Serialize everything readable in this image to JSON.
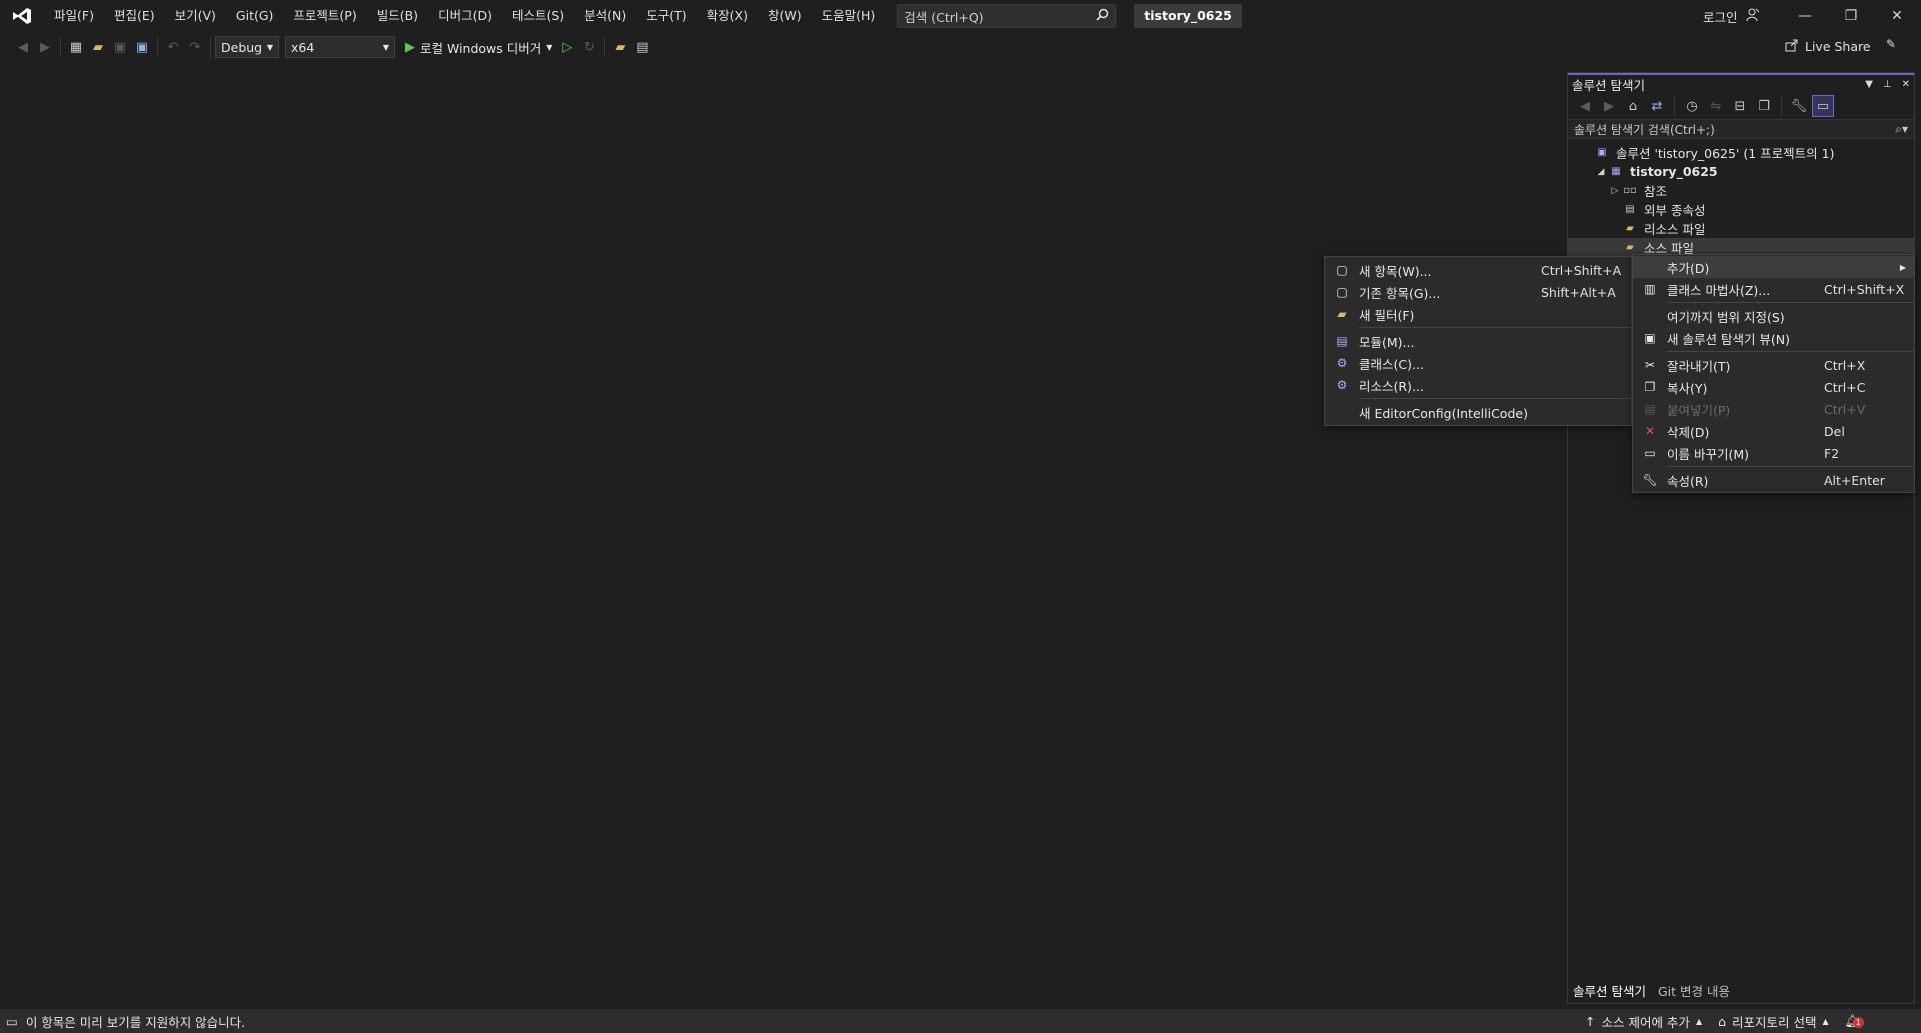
{
  "menu": {
    "items": [
      "파일(F)",
      "편집(E)",
      "보기(V)",
      "Git(G)",
      "프로젝트(P)",
      "빌드(B)",
      "디버그(D)",
      "테스트(S)",
      "분석(N)",
      "도구(T)",
      "확장(X)",
      "창(W)",
      "도움말(H)"
    ]
  },
  "search": {
    "placeholder": "검색 (Ctrl+Q)"
  },
  "solution_name": "tistory_0625",
  "account": {
    "login_label": "로그인"
  },
  "toolbar": {
    "config": "Debug",
    "platform": "x64",
    "run_label": "로컬 Windows 디버거",
    "live_share": "Live Share"
  },
  "solution_explorer": {
    "title": "솔루션 탐색기",
    "search_placeholder": "솔루션 탐색기 검색(Ctrl+;)",
    "tree": [
      {
        "label": "솔루션 'tistory_0625' (1 프로젝트의 1)",
        "level": 0,
        "icon": "solution-icon"
      },
      {
        "label": "tistory_0625",
        "level": 1,
        "icon": "project-icon",
        "bold": true
      },
      {
        "label": "참조",
        "level": 2,
        "icon": "references-icon"
      },
      {
        "label": "외부 종속성",
        "level": 2,
        "icon": "external-deps-icon"
      },
      {
        "label": "리소스 파일",
        "level": 2,
        "icon": "folder-icon"
      },
      {
        "label": "소스 파일",
        "level": 2,
        "icon": "folder-icon"
      }
    ],
    "tabs": [
      "솔루션 탐색기",
      "Git 변경 내용"
    ]
  },
  "context_menu": {
    "items": [
      {
        "label": "추가(D)",
        "shortcut": "",
        "icon": "",
        "submenu": true,
        "highlight": true
      },
      {
        "label": "클래스 마법사(Z)...",
        "shortcut": "Ctrl+Shift+X",
        "icon": "class-wizard-icon"
      },
      {
        "sep": true
      },
      {
        "label": "여기까지 범위 지정(S)",
        "shortcut": "",
        "icon": ""
      },
      {
        "label": "새 솔루션 탐색기 뷰(N)",
        "shortcut": "",
        "icon": "new-view-icon"
      },
      {
        "sep": true
      },
      {
        "label": "잘라내기(T)",
        "shortcut": "Ctrl+X",
        "icon": "cut-icon"
      },
      {
        "label": "복사(Y)",
        "shortcut": "Ctrl+C",
        "icon": "copy-icon"
      },
      {
        "label": "붙여넣기(P)",
        "shortcut": "Ctrl+V",
        "icon": "paste-icon",
        "disabled": true
      },
      {
        "label": "삭제(D)",
        "shortcut": "Del",
        "icon": "delete-icon"
      },
      {
        "label": "이름 바꾸기(M)",
        "shortcut": "F2",
        "icon": "rename-icon"
      },
      {
        "sep": true
      },
      {
        "label": "속성(R)",
        "shortcut": "Alt+Enter",
        "icon": "wrench-icon"
      }
    ]
  },
  "submenu": {
    "items": [
      {
        "label": "새 항목(W)...",
        "shortcut": "Ctrl+Shift+A",
        "icon": "new-item-icon"
      },
      {
        "label": "기존 항목(G)...",
        "shortcut": "Shift+Alt+A",
        "icon": "existing-item-icon"
      },
      {
        "label": "새 필터(F)",
        "shortcut": "",
        "icon": "new-filter-icon"
      },
      {
        "sep": true
      },
      {
        "label": "모듈(M)...",
        "shortcut": "",
        "icon": "module-icon"
      },
      {
        "label": "클래스(C)...",
        "shortcut": "",
        "icon": "class-icon"
      },
      {
        "label": "리소스(R)...",
        "shortcut": "",
        "icon": "resource-icon"
      },
      {
        "sep": true
      },
      {
        "label": "새 EditorConfig(IntelliCode)",
        "shortcut": "",
        "icon": ""
      }
    ]
  },
  "status_bar": {
    "message": "이 항목은 미리 보기를 지원하지 않습니다.",
    "source_control": "소스 제어에 추가",
    "repository": "리포지토리 선택",
    "notification_count": "1"
  },
  "colors": {
    "accent": "#6b67c7",
    "bg": "#1f1f1f",
    "menu_bg": "#2b2b2b"
  }
}
